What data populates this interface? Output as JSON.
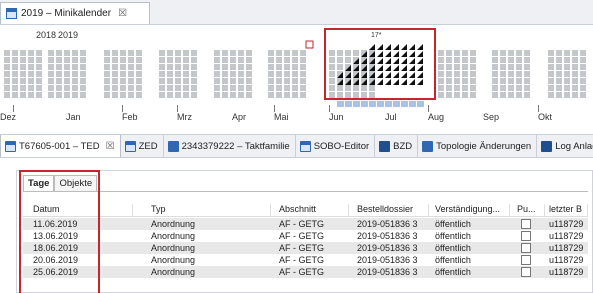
{
  "top_tab": {
    "title": "2019 – Minikalender",
    "close": "☒"
  },
  "calendar": {
    "years": [
      "2018",
      "2019"
    ],
    "week_marker": "17*",
    "months": [
      "Dez",
      "Jan",
      "Feb",
      "Mrz",
      "Apr",
      "Mai",
      "Jun",
      "Jul",
      "Aug",
      "Sep",
      "Okt"
    ]
  },
  "bottom_tabs": [
    {
      "label": "T67605-001 – TED",
      "close": "☒",
      "icon": "calendar-icon"
    },
    {
      "label": "ZED",
      "icon": "calendar-icon"
    },
    {
      "label": "2343379222 – Taktfamilie",
      "icon": "group-icon"
    },
    {
      "label": "SOBO-Editor",
      "icon": "calendar-icon"
    },
    {
      "label": "BZD",
      "icon": "table-icon"
    },
    {
      "label": "Topologie Änderungen",
      "icon": "topology-icon"
    },
    {
      "label": "Log Anlag",
      "icon": "log-icon"
    }
  ],
  "subtabs": [
    "Tage",
    "Objekte"
  ],
  "table": {
    "headers": [
      "Datum",
      "Typ",
      "Abschnitt",
      "Bestelldossier",
      "Verständigung...",
      "Pu...",
      "letzter B"
    ],
    "rows": [
      [
        "11.06.2019",
        "Anordnung",
        "AF - GETG",
        "2019-051836 3",
        "öffentlich",
        "",
        "u118729"
      ],
      [
        "13.06.2019",
        "Anordnung",
        "AF - GETG",
        "2019-051836 3",
        "öffentlich",
        "",
        "u118729"
      ],
      [
        "18.06.2019",
        "Anordnung",
        "AF - GETG",
        "2019-051836 3",
        "öffentlich",
        "",
        "u118729"
      ],
      [
        "20.06.2019",
        "Anordnung",
        "AF - GETG",
        "2019-051836 3",
        "öffentlich",
        "",
        "u118729"
      ],
      [
        "25.06.2019",
        "Anordnung",
        "AF - GETG",
        "2019-051836 3",
        "öffentlich",
        "",
        "u118729"
      ]
    ]
  },
  "colors": {
    "highlight": "#c4262e",
    "week_grey": "#c3c6cb",
    "week_selected": "#a9c1e6",
    "marked": "#111111"
  }
}
